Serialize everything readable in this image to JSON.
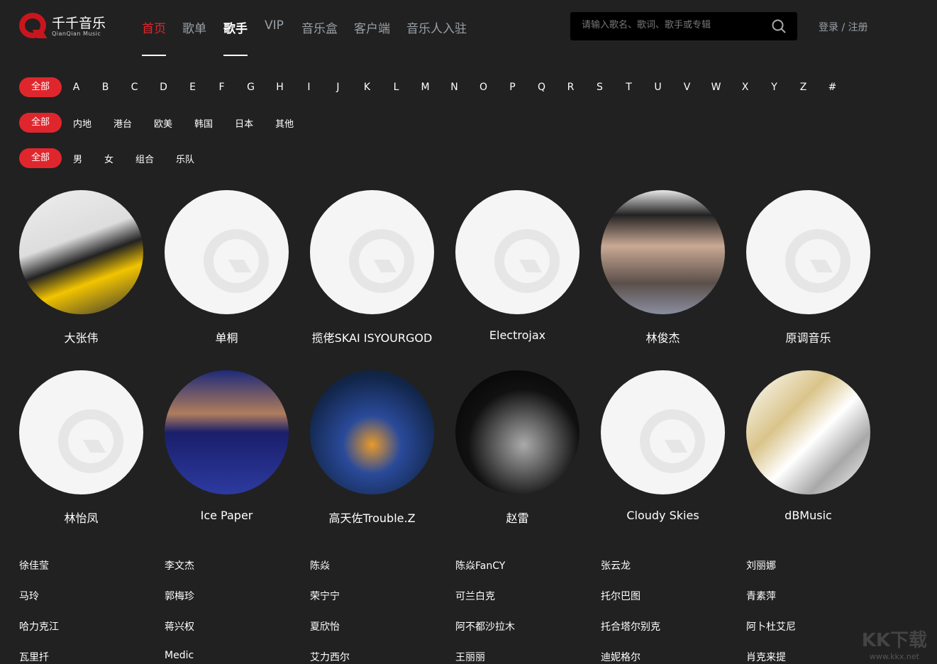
{
  "logo": {
    "cn": "千千音乐",
    "en": "QianQian Music"
  },
  "nav": [
    "首页",
    "歌单",
    "歌手",
    "VIP",
    "音乐盒",
    "客户端",
    "音乐人入驻"
  ],
  "search": {
    "placeholder": "请输入歌名、歌词、歌手或专辑"
  },
  "login": "登录 / 注册",
  "filters": {
    "letters": [
      "全部",
      "A",
      "B",
      "C",
      "D",
      "E",
      "F",
      "G",
      "H",
      "I",
      "J",
      "K",
      "L",
      "M",
      "N",
      "O",
      "P",
      "Q",
      "R",
      "S",
      "T",
      "U",
      "V",
      "W",
      "X",
      "Y",
      "Z",
      "#"
    ],
    "regions": [
      "全部",
      "内地",
      "港台",
      "欧美",
      "韩国",
      "日本",
      "其他"
    ],
    "genders": [
      "全部",
      "男",
      "女",
      "组合",
      "乐队"
    ]
  },
  "artists": [
    {
      "name": "大张伟",
      "photo": true,
      "bg": "linear-gradient(160deg,#eee 0%,#ddd 40%,#222 55%,#f2c400 70%,#333 100%)"
    },
    {
      "name": "单桐",
      "photo": false
    },
    {
      "name": "揽佬SKAI ISYOURGOD",
      "photo": false
    },
    {
      "name": "Electrojax",
      "photo": false
    },
    {
      "name": "林俊杰",
      "photo": true,
      "bg": "linear-gradient(180deg,#e8e8e8 0%,#222 20%,#c9a994 45%,#5b4f4a 75%,#8a8ea0 100%)"
    },
    {
      "name": "原调音乐",
      "photo": false
    },
    {
      "name": "林怡凤",
      "photo": false
    },
    {
      "name": "Ice Paper",
      "photo": true,
      "bg": "linear-gradient(180deg,#1e2a7a 0%,#b07d5c 35%,#1a1f6a 50%,#2d3aa0 100%)"
    },
    {
      "name": "高天佐Trouble.Z",
      "photo": true,
      "bg": "radial-gradient(circle at 50% 60%,#e89a2a 0%,#2a4a9a 30%,#12264a 70%,#0d1a2e 100%)"
    },
    {
      "name": "赵雷",
      "photo": true,
      "bg": "radial-gradient(circle at 55% 60%,#aaa 0%,#666 25%,#111 55%,#000 100%)"
    },
    {
      "name": "Cloudy Skies",
      "photo": false
    },
    {
      "name": "dBMusic",
      "photo": true,
      "bg": "linear-gradient(135deg,#fff 0%,#d9c48a 35%,#fff 55%,#a8a8a8 75%,#fff 100%)"
    }
  ],
  "more_artists": [
    [
      "徐佳莹",
      "李文杰",
      "陈焱",
      "陈焱FanCY",
      "张云龙",
      "刘丽娜"
    ],
    [
      "马玲",
      "郭梅珍",
      "荣宁宁",
      "可兰白克",
      "托尔巴图",
      "青素萍"
    ],
    [
      "哈力克江",
      "蒋兴权",
      "夏欣怡",
      "阿不都沙拉木",
      "托合塔尔别克",
      "阿卜杜艾尼"
    ],
    [
      "瓦里扦",
      "Medic",
      "艾力西尔",
      "王丽丽",
      "迪妮格尔",
      "肖克来提"
    ]
  ],
  "watermark": {
    "logo": "KK下载",
    "url": "www.kkx.net"
  },
  "colors": {
    "accent": "#e0262d",
    "background": "#212121"
  }
}
